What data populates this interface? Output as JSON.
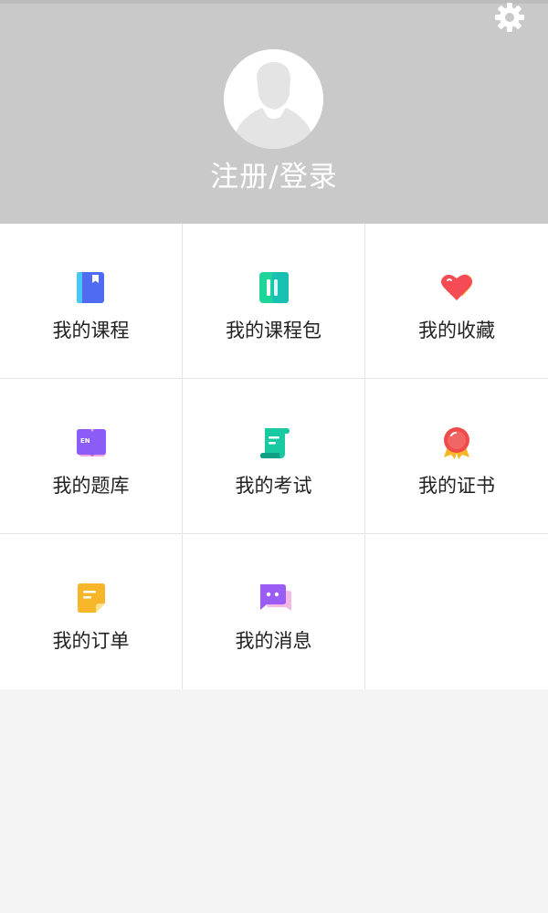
{
  "header": {
    "login_label": "注册/登录",
    "settings_icon": "gear-icon",
    "avatar_icon": "default-avatar-icon",
    "background": "#c9c9c9"
  },
  "menu": {
    "items": [
      {
        "label": "我的课程",
        "icon": "course-book-icon",
        "color": "#4f6cf0"
      },
      {
        "label": "我的课程包",
        "icon": "course-package-icon",
        "color": "#1fd49a"
      },
      {
        "label": "我的收藏",
        "icon": "heart-icon",
        "color": "#f54b55"
      },
      {
        "label": "我的题库",
        "icon": "question-bank-en-icon",
        "color": "#8b5cf6"
      },
      {
        "label": "我的考试",
        "icon": "exam-scroll-icon",
        "color": "#19c9a1"
      },
      {
        "label": "我的证书",
        "icon": "certificate-medal-icon",
        "color": "#f04a4a"
      },
      {
        "label": "我的订单",
        "icon": "order-note-icon",
        "color": "#f7b52a"
      },
      {
        "label": "我的消息",
        "icon": "message-chat-icon",
        "color": "#9b5cf6"
      }
    ]
  }
}
